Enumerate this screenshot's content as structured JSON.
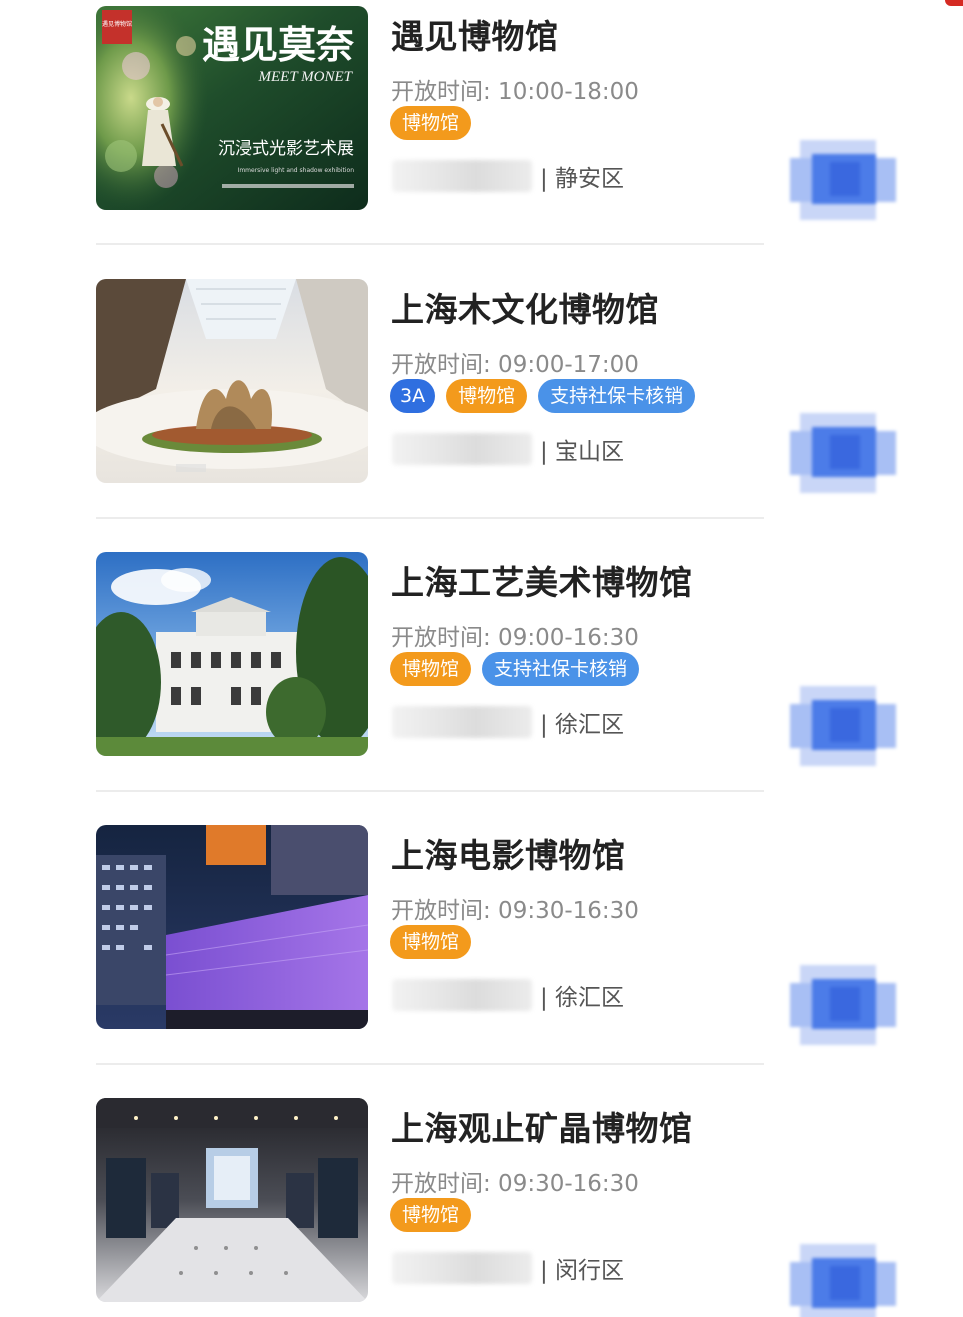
{
  "colors": {
    "tag_museum": "#f39a1c",
    "tag_social_card": "#4a92e8",
    "tag_grade": "#2f6fe0",
    "title_text": "#222222",
    "muted_text": "#8a8a8a"
  },
  "museums": [
    {
      "name": "遇见博物馆",
      "hours": "开放时间: 10:00-18:00",
      "tags": {
        "grade": "",
        "category": "博物馆",
        "social_card": ""
      },
      "district": "| 静安区",
      "image": {
        "badge": "遇见博物馆",
        "title": "遇见莫奈",
        "subtitle": "MEET MONET",
        "caption": "沉浸式光影艺术展",
        "caption_en": "Immersive light and shadow exhibition"
      }
    },
    {
      "name": "上海木文化博物馆",
      "hours": "开放时间: 09:00-17:00",
      "tags": {
        "grade": "3A",
        "category": "博物馆",
        "social_card": "支持社保卡核销"
      },
      "district": "| 宝山区"
    },
    {
      "name": "上海工艺美术博物馆",
      "hours": "开放时间: 09:00-16:30",
      "tags": {
        "grade": "",
        "category": "博物馆",
        "social_card": "支持社保卡核销"
      },
      "district": "| 徐汇区"
    },
    {
      "name": "上海电影博物馆",
      "hours": "开放时间: 09:30-16:30",
      "tags": {
        "grade": "",
        "category": "博物馆",
        "social_card": ""
      },
      "district": "| 徐汇区"
    },
    {
      "name": "上海观止矿晶博物馆",
      "hours": "开放时间: 09:30-16:30",
      "tags": {
        "grade": "",
        "category": "博物馆",
        "social_card": ""
      },
      "district": "| 闵行区"
    }
  ]
}
